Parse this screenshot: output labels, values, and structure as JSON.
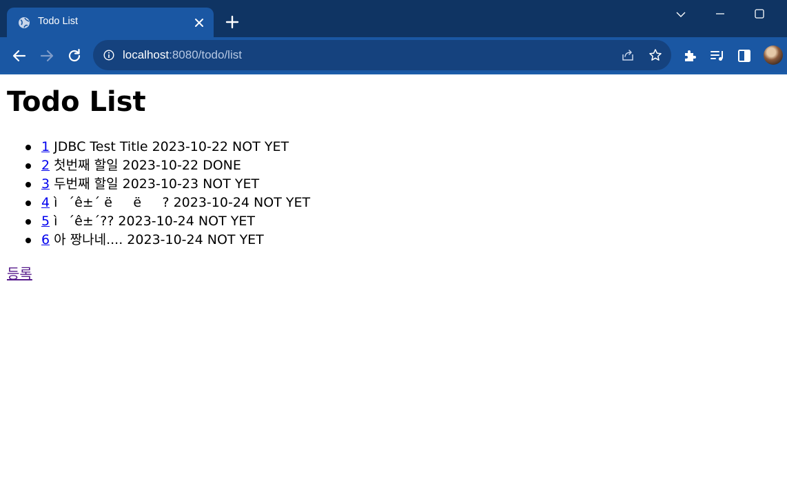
{
  "browser": {
    "tab_title": "Todo List",
    "url_host": "localhost",
    "url_rest": ":8080/todo/list",
    "icons": [
      "globe-icon",
      "close-icon",
      "plus-icon",
      "chevron-down-icon",
      "minimize-icon",
      "maximize-icon",
      "back-icon",
      "forward-icon",
      "reload-icon",
      "info-icon",
      "share-icon",
      "star-icon",
      "extensions-icon",
      "media-icon",
      "side-panel-icon",
      "avatar"
    ],
    "colors": {
      "tabstrip": "#0f3463",
      "toolbar": "#1a57a3",
      "omnibox": "#15427e"
    }
  },
  "page": {
    "title": "Todo List",
    "items": [
      {
        "id": "1",
        "text": "JDBC Test Title 2023-10-22 NOT YET"
      },
      {
        "id": "2",
        "text": "첫번째 할일 2023-10-22 DONE"
      },
      {
        "id": "3",
        "text": "두번째 할일 2023-10-23 NOT YET"
      },
      {
        "id": "4",
        "text": "ì´ê±´ ëë? 2023-10-24 NOT YET"
      },
      {
        "id": "5",
        "text": "ì´ê±´?? 2023-10-24 NOT YET"
      },
      {
        "id": "6",
        "text": "아 짱나네.... 2023-10-24 NOT YET"
      }
    ],
    "register_link": "등록",
    "colors": {
      "link": "#0000ee",
      "visited_link": "#551a8b"
    }
  }
}
